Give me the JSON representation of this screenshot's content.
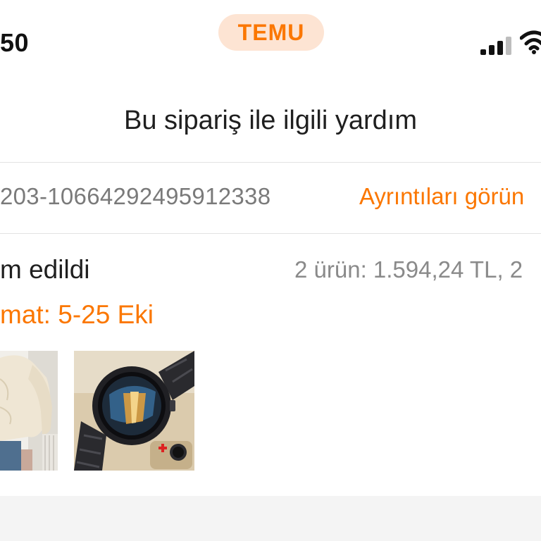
{
  "status_bar": {
    "time": "50",
    "brand": "TEMU",
    "signal_icon": "cellular-signal-icon",
    "wifi_icon": "wifi-icon"
  },
  "page": {
    "title": "Bu sipariş ile ilgili yardım"
  },
  "order": {
    "number": "203-10664292495912338",
    "details_link": "Ayrıntıları görün",
    "status": "m edildi",
    "summary": "2 ürün: 1.594,24 TL, 2",
    "delivery_estimate": "mat: 5-25 Eki",
    "items": [
      {
        "icon": "sweater-product-image"
      },
      {
        "icon": "smartwatch-product-image"
      }
    ]
  },
  "colors": {
    "accent": "#fb7701",
    "accent_pill_bg": "#fde4d3",
    "muted_text": "#7a7a7a",
    "divider": "#e3e3e3",
    "section_bg": "#f4f4f4"
  }
}
